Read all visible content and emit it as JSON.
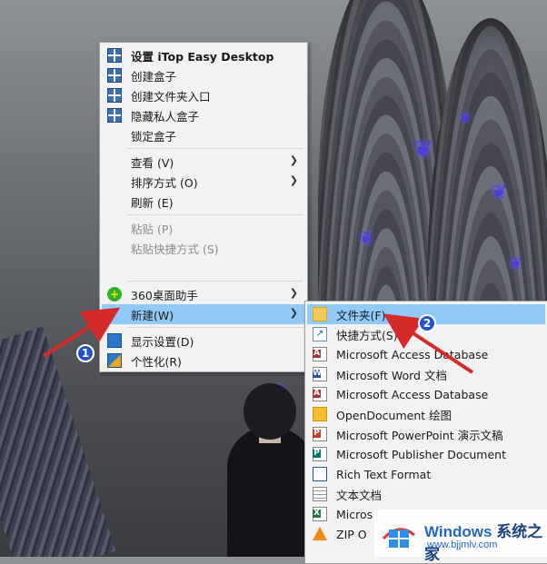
{
  "context_menu": {
    "items": [
      {
        "label": "设置 iTop Easy Desktop",
        "icon": "itop-icon"
      },
      {
        "label": "创建盒子",
        "icon": "itop-icon"
      },
      {
        "label": "创建文件夹入口",
        "icon": "itop-icon"
      },
      {
        "label": "隐藏私人盒子",
        "icon": "itop-icon"
      },
      {
        "label": "锁定盒子"
      },
      {
        "label": "查看 (V)"
      },
      {
        "label": "排序方式 (O)"
      },
      {
        "label": "刷新 (E)"
      },
      {
        "label": "粘贴 (P)"
      },
      {
        "label": "粘贴快捷方式 (S)"
      },
      {
        "label": "360桌面助手",
        "icon": "360-assistant-icon"
      },
      {
        "label": "新建(W)"
      },
      {
        "label": "显示设置(D)",
        "icon": "display-settings-icon"
      },
      {
        "label": "个性化(R)",
        "icon": "personalize-icon"
      }
    ]
  },
  "new_submenu": {
    "items": [
      {
        "label": "文件夹(F)",
        "icon": "folder-icon"
      },
      {
        "label": "快捷方式(S)",
        "icon": "shortcut-icon"
      },
      {
        "label": "Microsoft Access Database",
        "icon": "access-icon",
        "badge": "A"
      },
      {
        "label": "Microsoft Word 文档",
        "icon": "word-icon",
        "badge": "W"
      },
      {
        "label": "Microsoft Access Database",
        "icon": "access-icon",
        "badge": "A"
      },
      {
        "label": "OpenDocument 绘图",
        "icon": "opendocument-drawing-icon"
      },
      {
        "label": "Microsoft PowerPoint 演示文稿",
        "icon": "powerpoint-icon",
        "badge": "P"
      },
      {
        "label": "Microsoft Publisher Document",
        "icon": "publisher-icon",
        "badge": "P"
      },
      {
        "label": "Rich Text Format",
        "icon": "rtf-icon"
      },
      {
        "label": "文本文档",
        "icon": "text-document-icon"
      },
      {
        "label": "Micros",
        "icon": "excel-icon",
        "badge": "X"
      },
      {
        "label": "ZIP O",
        "icon": "zip-icon"
      }
    ]
  },
  "annotations": {
    "step1": "1",
    "step2": "2"
  },
  "watermark": {
    "title_en": "Windows",
    "title_cn": "系统之家",
    "url": "www.bjjmlv.com"
  },
  "colors": {
    "highlight": "#91c9f7",
    "menu_bg": "#f2f2f2",
    "arrow_red": "#d42a2a",
    "badge_blue": "#2453c7"
  }
}
